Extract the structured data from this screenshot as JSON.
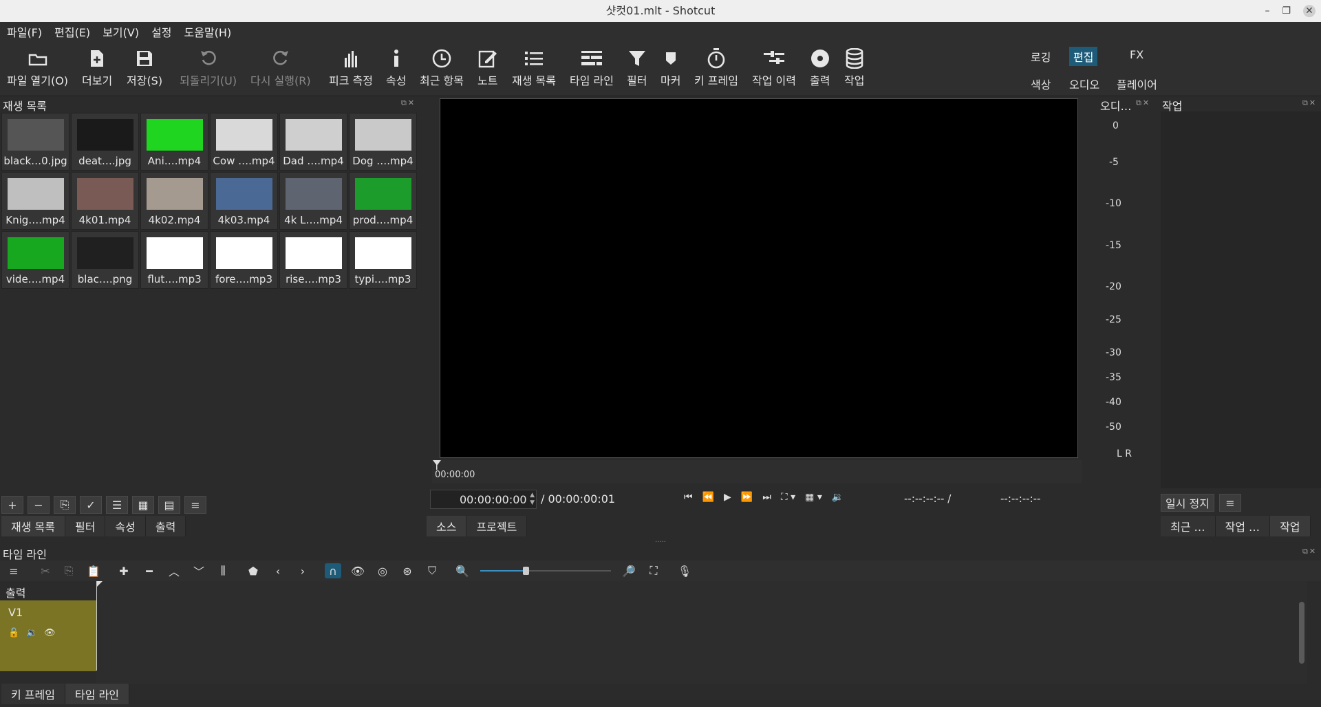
{
  "window": {
    "title": "샷컷01.mlt - Shotcut"
  },
  "menu": [
    "파일(F)",
    "편집(E)",
    "보기(V)",
    "설정",
    "도움말(H)"
  ],
  "toolbar": {
    "open": "파일 열기(O)",
    "more": "더보기",
    "save": "저장(S)",
    "undo": "되돌리기(U)",
    "redo": "다시 실행(R)",
    "peak": "피크 측정",
    "props": "속성",
    "recent": "최근 항목",
    "notes": "노트",
    "playlist": "재생 목록",
    "timeline": "타임 라인",
    "filter": "필터",
    "marker": "마커",
    "keyframe": "키 프레임",
    "history": "작업 이력",
    "export": "출력",
    "jobs": "작업"
  },
  "modes": {
    "logging": "로깅",
    "editing": "편집",
    "fx": "FX",
    "color": "색상",
    "audio": "오디오",
    "player": "플레이어"
  },
  "playlist": {
    "title": "재생 목록",
    "items": [
      {
        "label": "black…0.jpg",
        "thumb": "#555555"
      },
      {
        "label": "deat….jpg",
        "thumb": "#1a1a1a"
      },
      {
        "label": "Ani….mp4",
        "thumb": "#1fd51f"
      },
      {
        "label": "Cow ….mp4",
        "thumb": "#d9d9d9"
      },
      {
        "label": "Dad ….mp4",
        "thumb": "#cfcfcf"
      },
      {
        "label": "Dog ….mp4",
        "thumb": "#c9c9c9"
      },
      {
        "label": "Knig….mp4",
        "thumb": "#bfbfbf"
      },
      {
        "label": "4k01.mp4",
        "thumb": "#7a5a55"
      },
      {
        "label": "4k02.mp4",
        "thumb": "#a59a90"
      },
      {
        "label": "4k03.mp4",
        "thumb": "#4a6a95"
      },
      {
        "label": "4k L….mp4",
        "thumb": "#5e6570"
      },
      {
        "label": "prod….mp4",
        "thumb": "#1c9c2a"
      },
      {
        "label": "vide….mp4",
        "thumb": "#18a820"
      },
      {
        "label": "blac….png",
        "thumb": "#202020"
      },
      {
        "label": "flut….mp3",
        "thumb": "#ffffff"
      },
      {
        "label": "fore….mp3",
        "thumb": "#ffffff"
      },
      {
        "label": "rise….mp3",
        "thumb": "#ffffff"
      },
      {
        "label": "typi….mp3",
        "thumb": "#ffffff"
      }
    ]
  },
  "left_tabs": [
    "재생 목록",
    "필터",
    "속성",
    "출력"
  ],
  "viewer": {
    "ruler_pos": "00:00:00",
    "timecode": "00:00:00:00",
    "duration": "/ 00:00:00:01",
    "in_point": "--:--:--:-- /",
    "out_point": "--:--:--:--"
  },
  "viewer_tabs": [
    "소스",
    "프로젝트"
  ],
  "audio_meter": {
    "title": "오디…",
    "scale": [
      "0",
      "-5",
      "-10",
      "-15",
      "-20",
      "-25",
      "-30",
      "-35",
      "-40",
      "-50"
    ],
    "channels": "L R"
  },
  "jobs": {
    "title": "작업",
    "pause": "일시 정지"
  },
  "right_tabs": [
    "최근 …",
    "작업 …",
    "작업"
  ],
  "timeline": {
    "title": "타임 라인",
    "output_label": "출력",
    "track": "V1"
  },
  "bottom_tabs": [
    "키 프레임",
    "타임 라인"
  ]
}
